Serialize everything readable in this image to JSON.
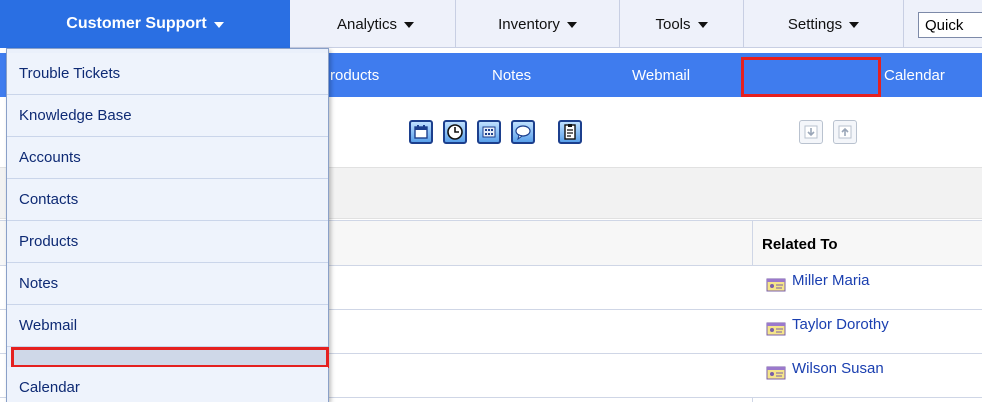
{
  "topnav": {
    "active": "Customer Support",
    "items": [
      "Analytics",
      "Inventory",
      "Tools",
      "Settings"
    ],
    "quick_search_value": "Quick"
  },
  "subnav": {
    "items": [
      "roducts",
      "Notes",
      "Webmail",
      "",
      "Calendar"
    ]
  },
  "toolbar": {
    "icons": [
      "calendar-icon",
      "clock-icon",
      "calculator-icon",
      "chat-bubble-icon",
      "clipboard-icon",
      "import-icon",
      "export-icon"
    ]
  },
  "table": {
    "related_to_header": "Related To",
    "rows": [
      "Miller Maria",
      "Taylor Dorothy",
      "Wilson Susan"
    ]
  },
  "dropdown": {
    "items": [
      "Trouble Tickets",
      "Knowledge Base",
      "Accounts",
      "Contacts",
      "Products",
      "Notes",
      "Webmail",
      "",
      "Calendar"
    ]
  },
  "colors": {
    "active_tab": "#2a6fe3",
    "subnav_bg": "#3f7cee",
    "highlight_red": "#e5201f",
    "link_blue": "#1a3fb0"
  }
}
